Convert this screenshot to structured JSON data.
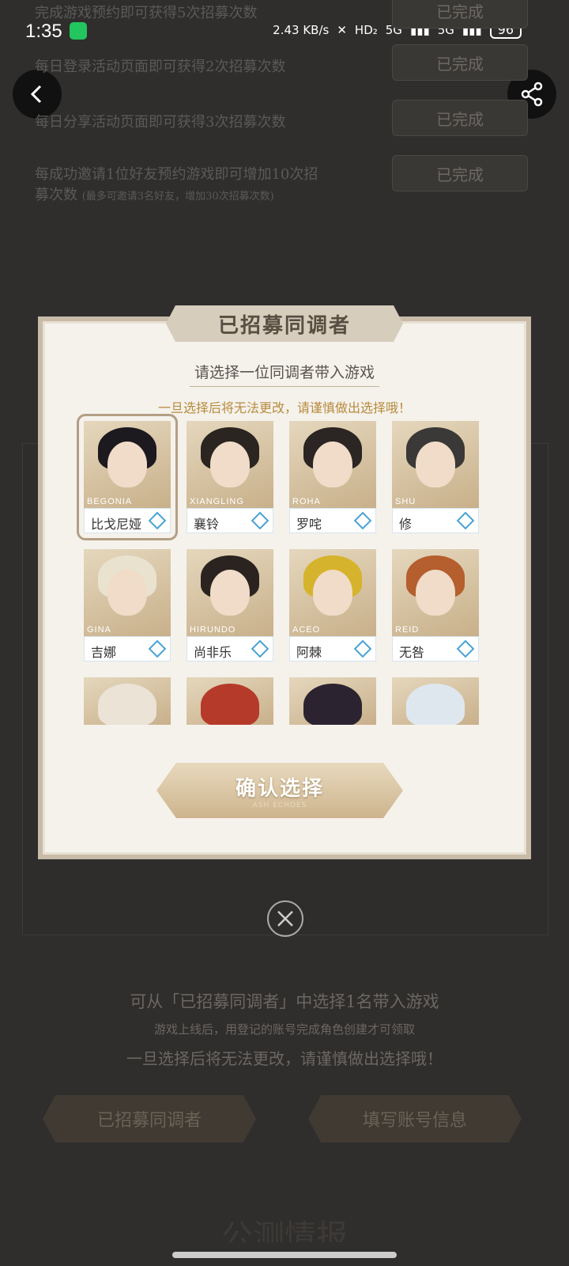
{
  "status": {
    "time": "1:35",
    "net_speed": "2.43 KB/s",
    "hd": "HD₂",
    "signal1": "5G",
    "signal2": "5G",
    "battery": "96"
  },
  "background": {
    "tasks": [
      {
        "text": "完成游戏预约即可获得5次招募次数",
        "btn": "已完成"
      },
      {
        "text": "每日登录活动页面即可获得2次招募次数",
        "btn": "已完成"
      },
      {
        "text": "每日分享活动页面即可获得3次招募次数",
        "btn": "已完成"
      },
      {
        "text": "每成功邀请1位好友预约游戏即可增加10次招募次数",
        "note": "(最多可邀请3名好友，增加30次招募次数)",
        "btn": "已完成"
      }
    ],
    "info1": "可从「已招募同调者」中选择1名带入游戏",
    "info2": "游戏上线后，用登记的账号完成角色创建才可领取",
    "info3": "一旦选择后将无法更改，请谨慎做出选择哦！",
    "btn_recruited": "已招募同调者",
    "btn_account": "填写账号信息",
    "bottom_partial_title": "公测情报"
  },
  "modal": {
    "title": "已招募同调者",
    "prompt": "请选择一位同调者带入游戏",
    "warning": "一旦选择后将无法更改，请谨慎做出选择哦！",
    "confirm": "确认选择",
    "confirm_watermark": "ASH ECHOES",
    "characters": [
      {
        "name": "比戈尼娅",
        "code": "BEGONIA",
        "selected": true,
        "hair": "#1c1a1f",
        "elem": "#4aa3d6"
      },
      {
        "name": "襄铃",
        "code": "XIANGLING",
        "hair": "#2a2521",
        "elem": "#4aa3d6"
      },
      {
        "name": "罗咤",
        "code": "ROHA",
        "hair": "#2b2523",
        "elem": "#4aa3d6"
      },
      {
        "name": "修",
        "code": "SHU",
        "hair": "#3a3937",
        "elem": "#4aa3d6"
      },
      {
        "name": "吉娜",
        "code": "GINA",
        "hair": "#e9e2cf",
        "elem": "#4aa3d6"
      },
      {
        "name": "尚非乐",
        "code": "HIRUNDO",
        "hair": "#2b2320",
        "elem": "#4aa3d6"
      },
      {
        "name": "阿棘",
        "code": "ACEO",
        "hair": "#d6b32c",
        "elem": "#4aa3d6"
      },
      {
        "name": "无咎",
        "code": "REID",
        "hair": "#b55e2e",
        "elem": "#4aa3d6"
      }
    ],
    "partial_colors": [
      "#eae3d6",
      "#b53a2a",
      "#2b2430",
      "#dfe7ee"
    ]
  }
}
